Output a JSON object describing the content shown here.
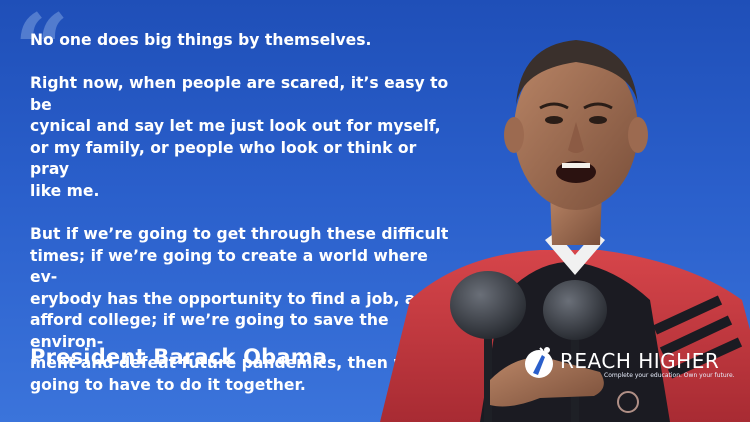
{
  "quote": {
    "paragraph_1": "No one does big things by themselves.",
    "paragraph_2_lines": [
      "Right now, when people are scared, it’s easy to be",
      "cynical and say let me just look out for myself,",
      "or my family, or people who look or think or pray",
      "like me."
    ],
    "paragraph_3_lines": [
      "But if we’re going to get through these difficult",
      "times; if we’re going to create a world where ev-",
      "erybody has the opportunity to find a job, and",
      "afford college; if we’re going to save the environ-",
      "ment and defeat future pandemics, then we’re",
      "going to have to do it together."
    ]
  },
  "attribution": "President Barack Obama",
  "logo": {
    "name": "REACH HIGHER",
    "tagline": "Complete your education. Own your future."
  },
  "colors": {
    "background_top": "#1f4fb8",
    "background_bottom": "#3b74db",
    "text": "#ffffff",
    "robe_red": "#c8383c",
    "robe_black": "#1b1b22"
  },
  "icons": {
    "quote_mark": "opening-quotation-mark",
    "logo_mark": "reach-higher-figure-icon"
  }
}
